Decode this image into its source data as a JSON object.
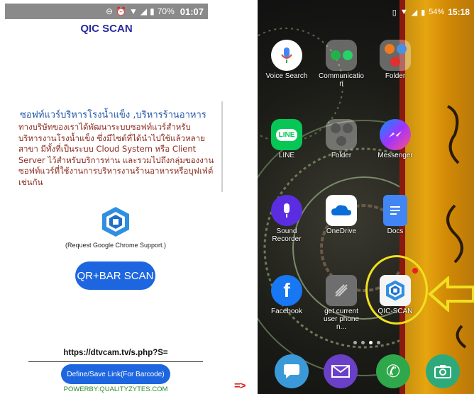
{
  "left_phone": {
    "status": {
      "battery": "70%",
      "time": "01:07"
    },
    "title": "QIC SCAN",
    "heading": "ซอฟท์แวร์บริหารโรงน้ำแข็ง ,บริหารร้านอาหาร",
    "description": "ทางบริษัทของเราได้พัฒนาระบบซอฟท์แวร์สำหรับบริหารงานโรงน้ำแข็ง ซึ่งมีไซต์ที่ได้นำไปใช้แล้วหลายสาขา มีทั้งที่เป็นระบบ Cloud System หรือ Client Server ไว้สำหรับบริการท่าน และรวมไปถึงกลุ่มของงานซอฟท์แวร์ที่ใช้งานการบริหารงานร้านอาหารหรือบุฟเฟ่ต์ เช่นกัน",
    "chrome_note": "(Request Google Chrome Support.)",
    "scan_button": "QR+BAR SCAN",
    "url": "https://dtvcam.tv/s.php?S=",
    "define_button": "Define/Save Link(For Barcode)",
    "powered_by": "POWERBY:QUALITYZYTES.COM"
  },
  "arrow_text": "=>",
  "right_phone": {
    "status": {
      "battery": "54%",
      "time": "15:18"
    },
    "apps": [
      {
        "label": "Voice Search",
        "icon": "mic-icon"
      },
      {
        "label": "Communicatio n",
        "icon": "folder-icon"
      },
      {
        "label": "Folder",
        "icon": "folder-icon"
      },
      {
        "label": "LINE",
        "icon": "line-icon"
      },
      {
        "label": "Folder",
        "icon": "folder-icon"
      },
      {
        "label": "Messenger",
        "icon": "messenger-icon"
      },
      {
        "label": "Sound Recorder",
        "icon": "mic-icon"
      },
      {
        "label": "OneDrive",
        "icon": "cloud-icon"
      },
      {
        "label": "Docs",
        "icon": "docs-icon"
      },
      {
        "label": "Facebook",
        "icon": "facebook-icon"
      },
      {
        "label": "get current user phone n...",
        "icon": "app-icon"
      },
      {
        "label": "QIC-SCAN",
        "icon": "qic-scan-icon"
      }
    ]
  }
}
